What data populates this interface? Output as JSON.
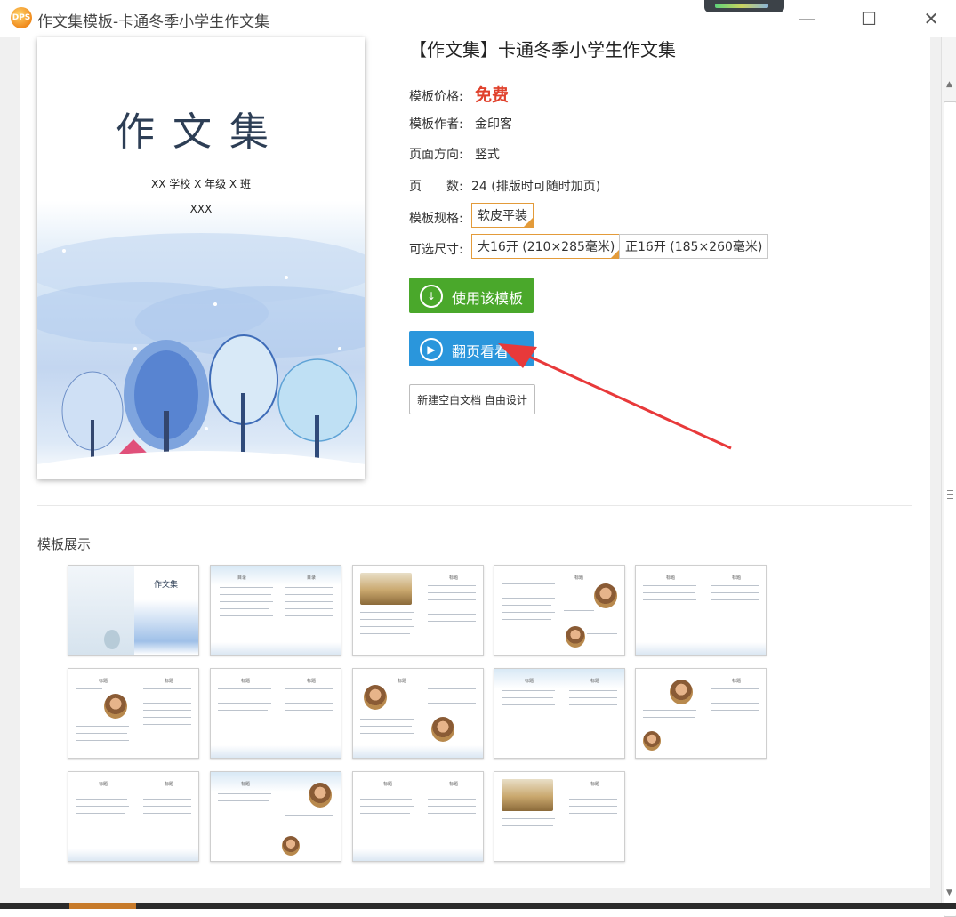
{
  "window": {
    "title": "作文集模板-卡通冬季小学生作文集",
    "logo_text": "DPS",
    "minimize": "—",
    "maximize": "☐",
    "close": "✕"
  },
  "cover": {
    "title": "作文集",
    "subtitle": "XX 学校 X 年级 X 班",
    "name": "XXX"
  },
  "detail": {
    "title": "【作文集】卡通冬季小学生作文集",
    "price_label": "模板价格:",
    "price_value": "免费",
    "author_label": "模板作者:",
    "author_value": "金印客",
    "orientation_label": "页面方向:",
    "orientation_value": "竖式",
    "pages_label": "页　　数:",
    "pages_value": "24 (排版时可随时加页)",
    "spec_label": "模板规格:",
    "spec_option": "软皮平装",
    "size_label": "可选尺寸:",
    "size_options": [
      "大16开 (210×285毫米)",
      "正16开 (185×260毫米)"
    ]
  },
  "buttons": {
    "use_template": "使用该模板",
    "flip_preview": "翻页看看",
    "new_blank": "新建空白文档 自由设计"
  },
  "gallery": {
    "title": "模板展示",
    "thumb_cover_title": "作文集",
    "page_heading": "标题",
    "toc_left": "目录",
    "toc_right": "目录"
  },
  "colors": {
    "price": "#e0412c",
    "use_button": "#4aa82b",
    "flip_button": "#2a96dc",
    "selected_border": "#e39b3a",
    "annotation_arrow": "#e8393a"
  },
  "icons": {
    "use_button": "download-circle-icon",
    "flip_button": "play-circle-icon"
  }
}
